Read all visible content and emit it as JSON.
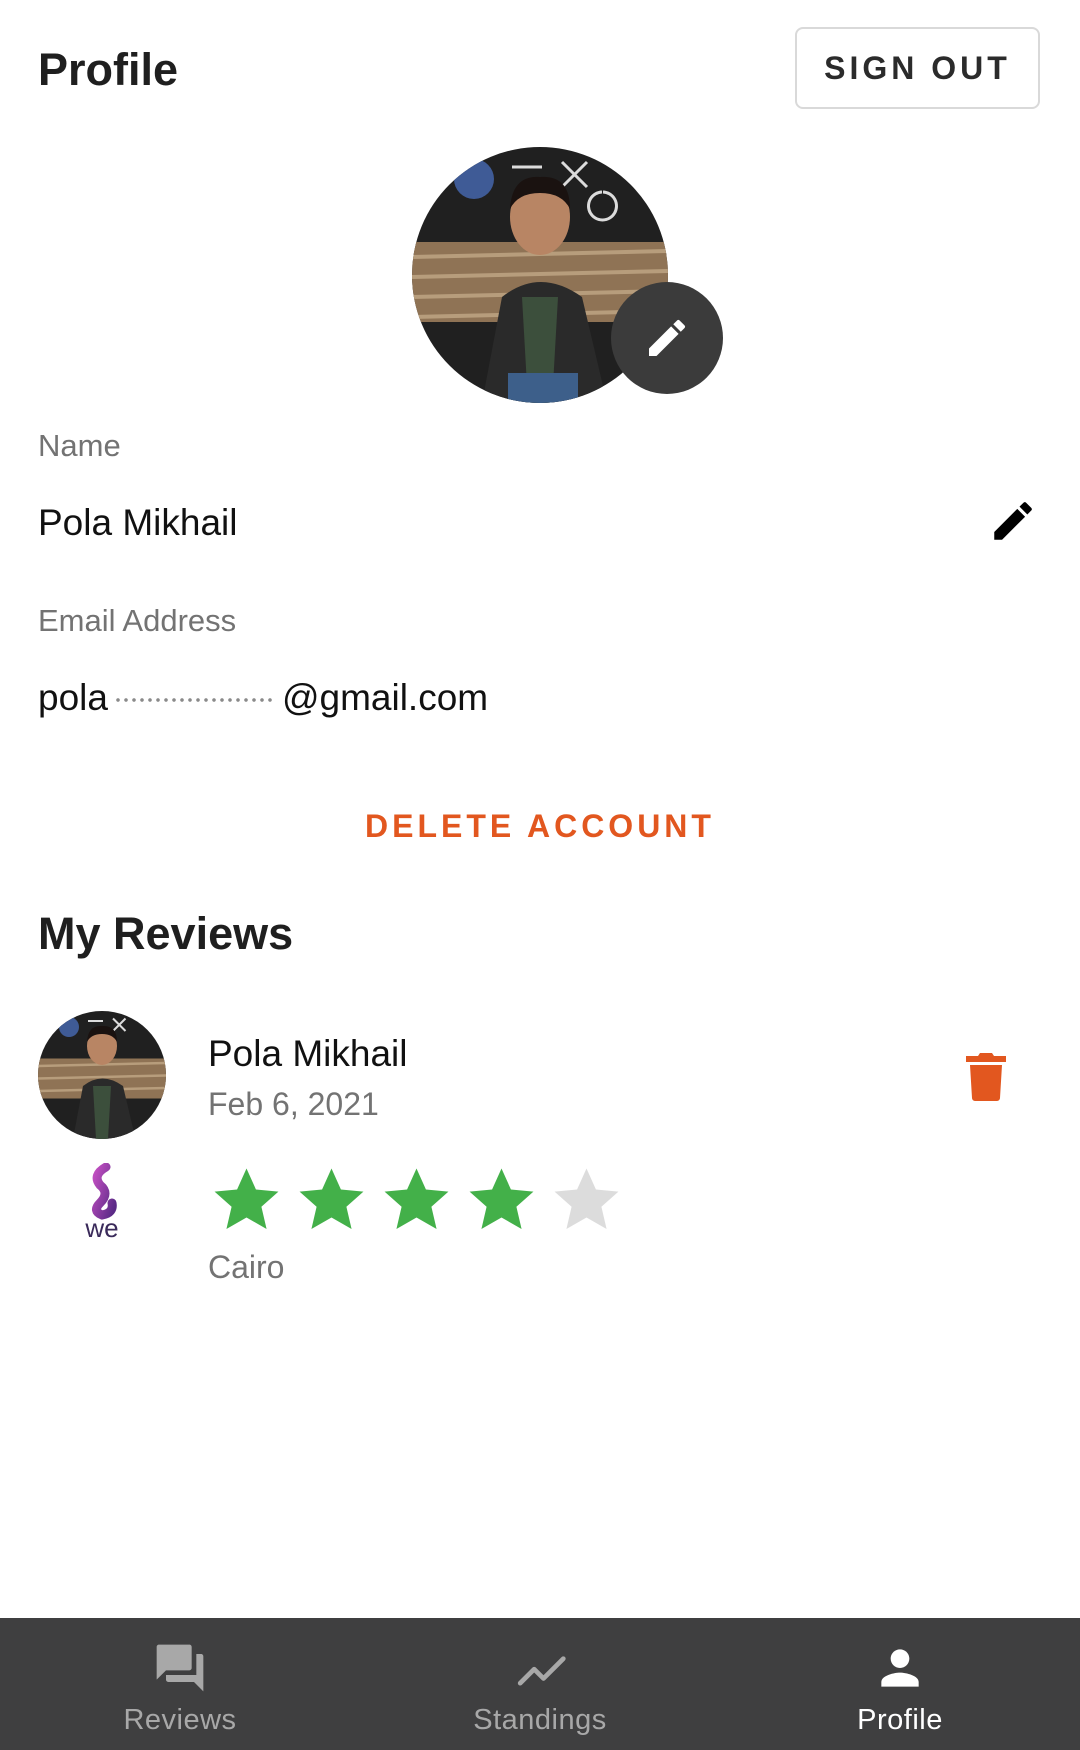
{
  "header": {
    "title": "Profile",
    "sign_out": "SIGN OUT"
  },
  "profile": {
    "name_label": "Name",
    "name_value": "Pola Mikhail",
    "email_label": "Email Address",
    "email_prefix": "pola",
    "email_suffix": "@gmail.com",
    "delete_account": "DELETE ACCOUNT"
  },
  "reviews": {
    "section_title": "My Reviews",
    "items": [
      {
        "reviewer": "Pola Mikhail",
        "date": "Feb 6, 2021",
        "location": "Cairo",
        "rating": 4,
        "max_rating": 5,
        "provider_icon": "we-logo"
      }
    ]
  },
  "bottom_nav": {
    "items": [
      {
        "label": "Reviews",
        "icon": "forum-icon",
        "active": false
      },
      {
        "label": "Standings",
        "icon": "trending-icon",
        "active": false
      },
      {
        "label": "Profile",
        "icon": "person-icon",
        "active": true
      }
    ]
  },
  "colors": {
    "accent": "#e2571f",
    "star_filled": "#43b049",
    "star_empty": "#dcdcdc",
    "nav_bg": "#3f3f40"
  },
  "icons": {
    "avatar_edit": "pencil-icon",
    "name_edit": "pencil-icon",
    "delete_review": "trash-icon"
  }
}
